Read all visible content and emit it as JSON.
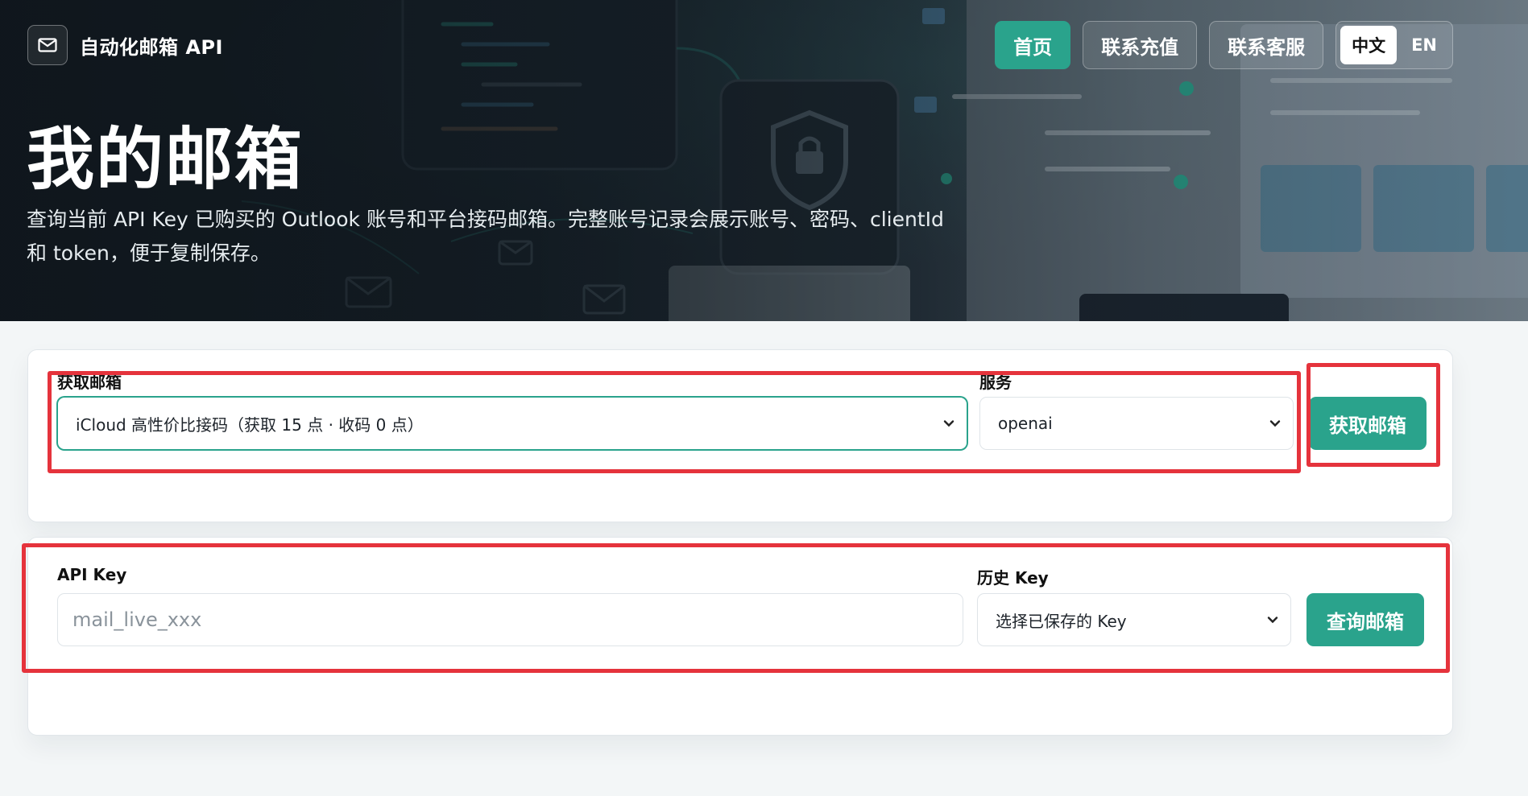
{
  "header": {
    "brand_name": "自动化邮箱 API",
    "nav": {
      "home": "首页",
      "recharge": "联系充值",
      "support": "联系客服"
    },
    "lang": {
      "zh": "中文",
      "en": "EN"
    }
  },
  "hero": {
    "title": "我的邮箱",
    "description": "查询当前 API Key 已购买的 Outlook 账号和平台接码邮箱。完整账号记录会展示账号、密码、clientId 和 token，便于复制保存。"
  },
  "get_mailbox": {
    "mailbox_label": "获取邮箱",
    "mailbox_selected": "iCloud 高性价比接码（获取 15 点 · 收码 0 点）",
    "service_label": "服务",
    "service_selected": "openai",
    "button_label": "获取邮箱"
  },
  "query": {
    "api_key_label": "API Key",
    "api_key_placeholder": "mail_live_xxx",
    "history_label": "历史 Key",
    "history_selected": "选择已保存的 Key",
    "button_label": "查询邮箱"
  },
  "colors": {
    "accent": "#2aa38c",
    "highlight": "#e5333c"
  }
}
